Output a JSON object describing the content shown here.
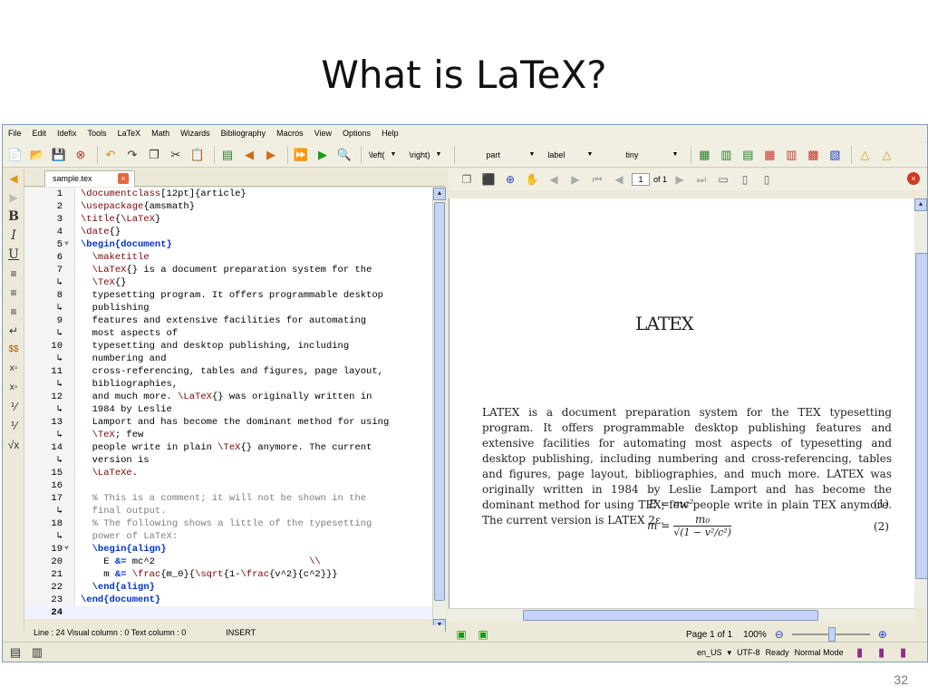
{
  "slide": {
    "title": "What is LaTeX?",
    "number": "32"
  },
  "menu": [
    "File",
    "Edit",
    "Idefix",
    "Tools",
    "LaTeX",
    "Math",
    "Wizards",
    "Bibliography",
    "Macros",
    "View",
    "Options",
    "Help"
  ],
  "toolbar": {
    "left_label": "\\left(",
    "right_label": "\\right)",
    "section_value": "part",
    "label_value": "label",
    "size_value": "tiny"
  },
  "sidebar_icons": [
    "arrow-left-icon",
    "arrow-right-icon",
    "bold-icon",
    "italic-icon",
    "underline-icon",
    "align-left-icon",
    "align-center-icon",
    "align-right-icon",
    "newline-icon",
    "math-icon",
    "subscript-icon",
    "superscript-icon",
    "frac-icon",
    "dfrac-icon",
    "sqrt-icon"
  ],
  "editor": {
    "tab_label": "sample.tex",
    "lines": [
      {
        "num": "1",
        "fold": "",
        "code": "<span class='cmd'>\\documentclass</span>[12pt]{article}"
      },
      {
        "num": "2",
        "fold": "",
        "code": "<span class='cmd'>\\usepackage</span>{amsmath}"
      },
      {
        "num": "3",
        "fold": "",
        "code": "<span class='cmd'>\\title</span>{<span class='cmd'>\\LaTeX</span>}"
      },
      {
        "num": "4",
        "fold": "",
        "code": "<span class='cmd'>\\date</span>{}"
      },
      {
        "num": "5",
        "fold": "▼",
        "code": "<span class='kw'>\\begin{document}</span>"
      },
      {
        "num": "6",
        "fold": "",
        "code": "  <span class='cmd'>\\maketitle</span>"
      },
      {
        "num": "7",
        "fold": "",
        "code": "  <span class='cmd'>\\LaTeX</span>{} is a document preparation system for the"
      },
      {
        "num": "↳",
        "fold": "",
        "code": "  <span class='cmd'>\\TeX</span>{}"
      },
      {
        "num": "8",
        "fold": "",
        "code": "  typesetting program. It offers programmable desktop"
      },
      {
        "num": "↳",
        "fold": "",
        "code": "  publishing"
      },
      {
        "num": "9",
        "fold": "",
        "code": "  features and extensive facilities for automating"
      },
      {
        "num": "↳",
        "fold": "",
        "code": "  most aspects of"
      },
      {
        "num": "10",
        "fold": "",
        "code": "  typesetting and desktop publishing, including"
      },
      {
        "num": "↳",
        "fold": "",
        "code": "  numbering and"
      },
      {
        "num": "11",
        "fold": "",
        "code": "  cross-referencing, tables and figures, page layout,"
      },
      {
        "num": "↳",
        "fold": "",
        "code": "  bibliographies,"
      },
      {
        "num": "12",
        "fold": "",
        "code": "  and much more. <span class='cmd'>\\LaTeX</span>{} was originally written in"
      },
      {
        "num": "↳",
        "fold": "",
        "code": "  1984 by Leslie"
      },
      {
        "num": "13",
        "fold": "",
        "code": "  Lamport and has become the dominant method for using"
      },
      {
        "num": "↳",
        "fold": "",
        "code": "  <span class='cmd'>\\TeX</span>; few"
      },
      {
        "num": "14",
        "fold": "",
        "code": "  people write in plain <span class='cmd'>\\TeX</span>{} anymore. The current"
      },
      {
        "num": "↳",
        "fold": "",
        "code": "  version is"
      },
      {
        "num": "15",
        "fold": "",
        "code": "  <span class='cmd'>\\LaTeXe</span>."
      },
      {
        "num": "16",
        "fold": "",
        "code": ""
      },
      {
        "num": "17",
        "fold": "",
        "code": "  <span class='cm'>% This is a comment; it will not be shown in the</span>"
      },
      {
        "num": "↳",
        "fold": "",
        "code": "  <span class='cm'>final output.</span>"
      },
      {
        "num": "18",
        "fold": "",
        "code": "  <span class='cm'>% The following shows a little of the typesetting</span>"
      },
      {
        "num": "↳",
        "fold": "",
        "code": "  <span class='cm'>power of LaTeX:</span>"
      },
      {
        "num": "19",
        "fold": "▼",
        "code": "  <span class='kw'>\\begin{align}</span>"
      },
      {
        "num": "20",
        "fold": "",
        "code": "    E <span class='kw'>&amp;=</span> mc^2                           <span class='cmd'>\\\\</span>"
      },
      {
        "num": "21",
        "fold": "",
        "code": "    m <span class='kw'>&amp;=</span> <span class='cmd'>\\frac</span>{m_0}{<span class='cmd'>\\sqrt</span>{1-<span class='cmd'>\\frac</span>{v^2}{c^2}}}"
      },
      {
        "num": "22",
        "fold": "",
        "code": "  <span class='kw'>\\end{align}</span>"
      },
      {
        "num": "23",
        "fold": "",
        "code": "<span class='kw'>\\end{document}</span>"
      },
      {
        "num": "24",
        "fold": "",
        "code": ""
      }
    ],
    "status": {
      "line": "Line : 24 Visual column : 0 Text column : 0",
      "mode": "INSERT"
    }
  },
  "viewer": {
    "page_field": "1",
    "page_of": "of 1",
    "doc_title": "LATEX",
    "doc_body": "LATEX is a document preparation system for the TEX typesetting program. It offers programmable desktop publishing features and extensive facilities for automating most aspects of typesetting and desktop publishing, including numbering and cross-referencing, tables and figures, page layout, bibliographies, and much more. LATEX was originally written in 1984 by Leslie Lamport and has become the dominant method for using TEX; few people write in plain TEX anymore. The current version is LATEX 2ε.",
    "eq1_lhs": "E = mc²",
    "eq1_num": "(1)",
    "eq2_lhs": "m =",
    "eq2_num_top": "m₀",
    "eq2_num_bottom": "√(1 − v²/c²)",
    "eq2_num": "(2)",
    "page_status": "Page 1 of 1",
    "zoom": "100%"
  },
  "bottom_status": {
    "lang": "en_US",
    "encoding": "UTF-8",
    "state": "Ready",
    "mode": "Normal Mode"
  }
}
